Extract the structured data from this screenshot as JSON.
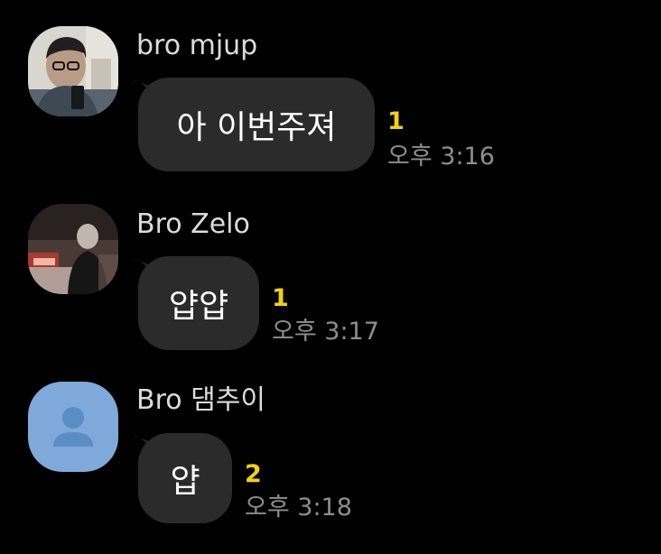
{
  "messages": [
    {
      "sender": "bro mjup",
      "text": "아 이번주져",
      "unread_count": "1",
      "time": "오후 3:16",
      "avatar": "photo-man-mirror-selfie"
    },
    {
      "sender": "Bro Zelo",
      "text": "얍얍",
      "unread_count": "1",
      "time": "오후 3:17",
      "avatar": "photo-blurry-night-street"
    },
    {
      "sender": "Bro 댐추이",
      "text": "얍",
      "unread_count": "2",
      "time": "오후 3:18",
      "avatar": "default-person-icon"
    }
  ],
  "colors": {
    "background": "#000000",
    "bubble": "#2b2b2b",
    "unread": "#f2d20f",
    "default_avatar": "#7fa9d8"
  }
}
